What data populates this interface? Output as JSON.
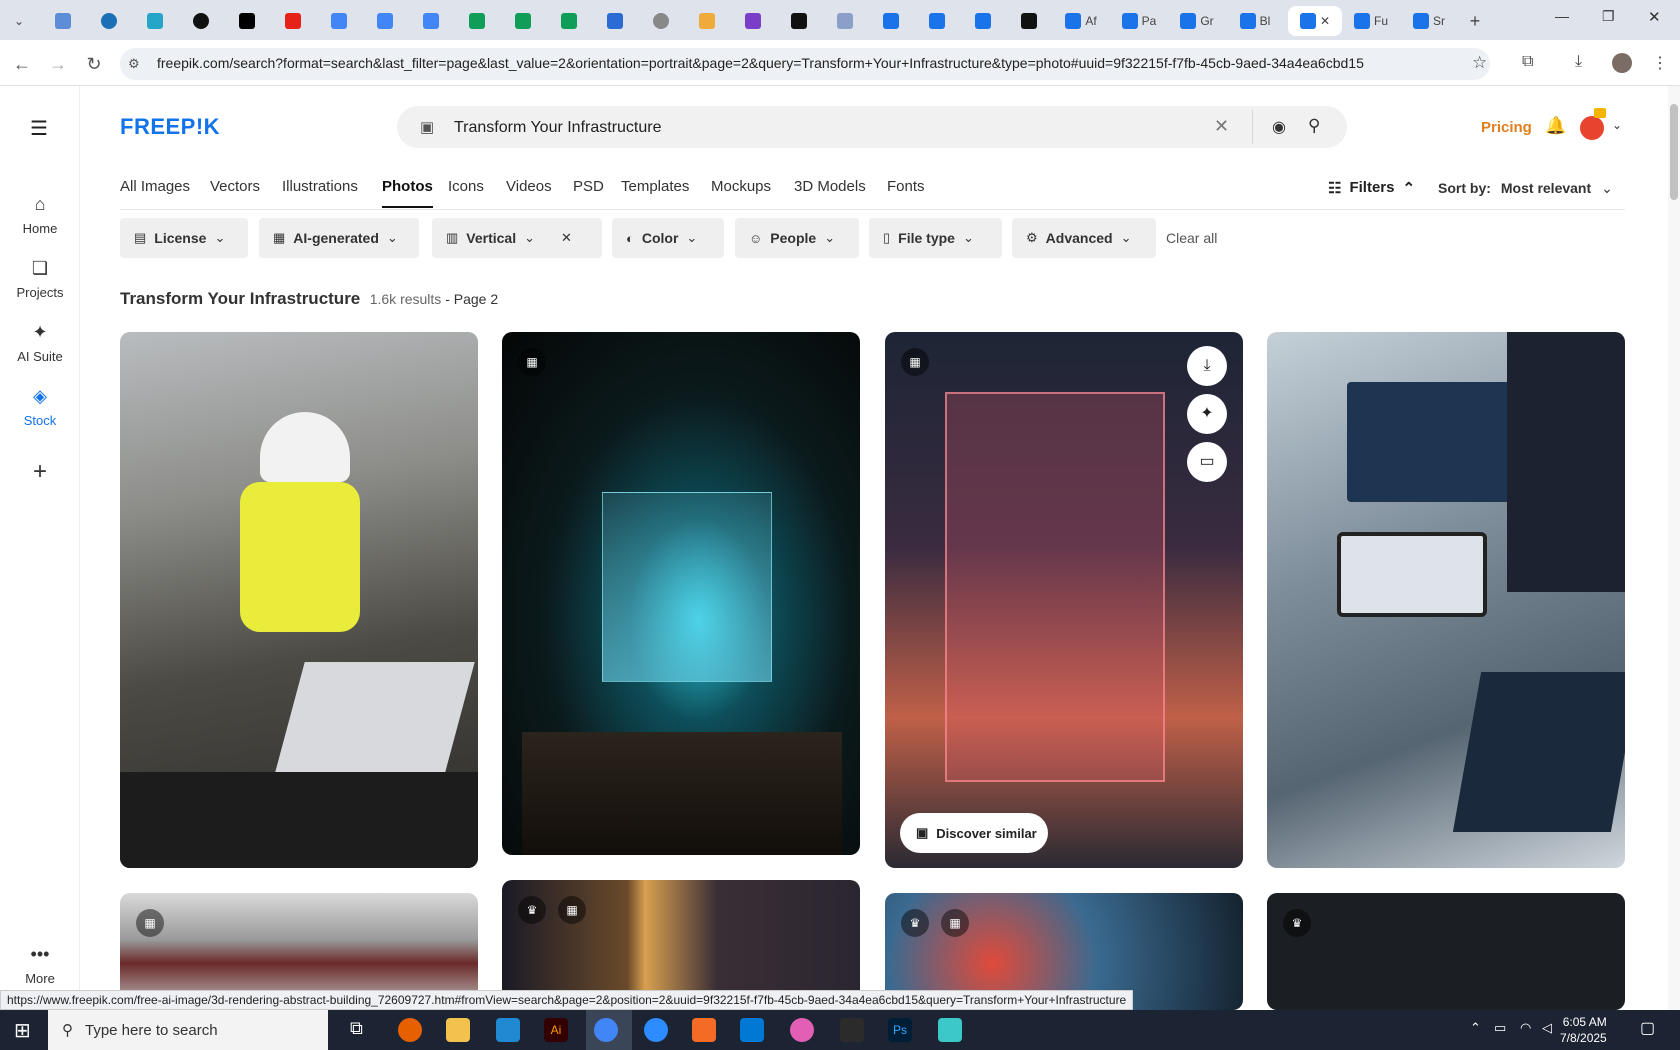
{
  "browser": {
    "tabs": [
      "Af",
      "Pa",
      "Gr",
      "Bl",
      "",
      "Fu",
      "Sr"
    ],
    "url": "freepik.com/search?format=search&last_filter=page&last_value=2&orientation=portrait&page=2&query=Transform+Your+Infrastructure&type=photo#uuid=9f32215f-f7fb-45cb-9aed-34a4ea6cbd15",
    "status_url": "https://www.freepik.com/free-ai-image/3d-rendering-abstract-building_72609727.htm#fromView=search&page=2&position=2&uuid=9f32215f-f7fb-45cb-9aed-34a4ea6cbd15&query=Transform+Your+Infrastructure"
  },
  "header": {
    "logo": "FREEP!K",
    "search_value": "Transform Your Infrastructure",
    "pricing": "Pricing"
  },
  "sidebar": {
    "items": [
      {
        "label": "Home"
      },
      {
        "label": "Projects"
      },
      {
        "label": "AI Suite"
      },
      {
        "label": "Stock"
      }
    ],
    "more": "More"
  },
  "categories": [
    "All Images",
    "Vectors",
    "Illustrations",
    "Photos",
    "Icons",
    "Videos",
    "PSD",
    "Templates",
    "Mockups",
    "3D Models",
    "Fonts"
  ],
  "active_category": "Photos",
  "filters_label": "Filters",
  "sort_label": "Sort by:",
  "sort_value": "Most relevant",
  "chips": [
    "License",
    "AI-generated",
    "Vertical",
    "Color",
    "People",
    "File type",
    "Advanced"
  ],
  "clear_all": "Clear all",
  "results": {
    "title": "Transform Your Infrastructure",
    "count": "1.6k results",
    "page": " - Page 2"
  },
  "discover_similar": "Discover similar",
  "taskbar": {
    "search_placeholder": "Type here to search",
    "time": "6:05 AM",
    "date": "7/8/2025"
  }
}
